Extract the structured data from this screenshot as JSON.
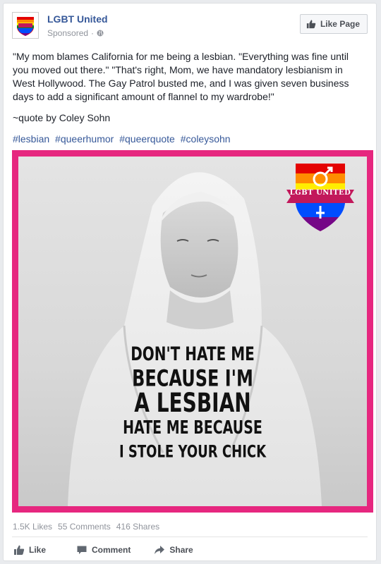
{
  "header": {
    "page_name": "LGBT United",
    "sponsored": "Sponsored",
    "sponsored_sep": "·",
    "like_page_label": "Like Page"
  },
  "post": {
    "text": "\"My mom blames California for me being a lesbian. \"Everything was fine until you moved out there.\" \"That's right, Mom, we have mandatory lesbianism in West Hollywood. The Gay Patrol busted me, and I was given seven business days to add a significant amount of flannel to my wardrobe!\"",
    "attribution": "~quote by Coley Sohn",
    "hashtags": [
      "#lesbian",
      "#queerhumor",
      "#queerquote",
      "#coleysohn"
    ]
  },
  "image": {
    "shirt_lines": [
      "DON'T HATE ME",
      "BECAUSE I'M",
      "A LESBIAN",
      "HATE ME BECAUSE",
      "I STOLE YOUR CHICK"
    ],
    "badge_text": "LGBT UNITED",
    "frame_color": "#e6277f"
  },
  "stats": {
    "likes": "1.5K Likes",
    "comments": "55 Comments",
    "shares": "416 Shares"
  },
  "actions": {
    "like": "Like",
    "comment": "Comment",
    "share": "Share"
  },
  "icons": {
    "avatar": "rainbow-logo-icon",
    "like_page": "thumbs-up-icon",
    "globe": "globe-icon",
    "comment": "comment-icon",
    "share": "share-icon"
  }
}
